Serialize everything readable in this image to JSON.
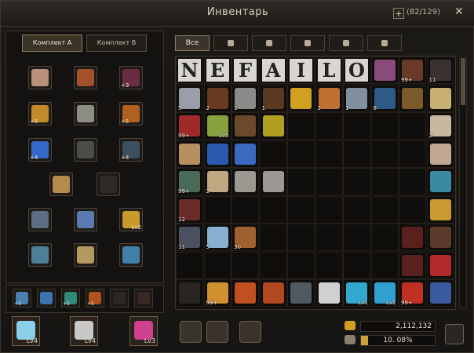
{
  "window": {
    "title": "Инвентарь",
    "capacity": "(82/129)",
    "close_glyph": "✕",
    "add_glyph": "+"
  },
  "equipment": {
    "presets": [
      "Комплект A",
      "Комплект B"
    ],
    "active_preset": 0,
    "slots": [
      {
        "c": "#b98f7a",
        "n": "",
        "lv": ""
      },
      {
        "c": "#a4502a",
        "n": "",
        "lv": ""
      },
      {
        "c": "#6b2b45",
        "n": "+3",
        "lv": ""
      },
      {
        "c": "#c48b2a",
        "n": "+5",
        "lv": ""
      },
      {
        "c": "#8d8c85",
        "n": "",
        "lv": ""
      },
      {
        "c": "#b06020",
        "n": "+5",
        "lv": ""
      },
      {
        "c": "#3468c8",
        "n": "+4",
        "lv": ""
      },
      {
        "c": "#4a4e47",
        "n": "",
        "lv": ""
      },
      {
        "c": "#3c4f5c",
        "n": "+4",
        "lv": ""
      },
      {
        "c": "#b58a4b",
        "n": "",
        "lv": ""
      },
      {
        "c": "#2d2a27",
        "n": "",
        "lv": ""
      },
      {
        "c": "#5b6e86",
        "n": "",
        "lv": ""
      },
      {
        "c": "#587ab0",
        "n": "",
        "lv": ""
      },
      {
        "c": "#c89a2e",
        "n": "",
        "lv": "Lv2"
      },
      {
        "c": "#4d7f99",
        "n": "",
        "lv": ""
      },
      {
        "c": "#b49960",
        "n": "",
        "lv": ""
      },
      {
        "c": "#3f7fa8",
        "n": "",
        "lv": ""
      }
    ]
  },
  "quickbar": [
    {
      "c": "#4b7fb0",
      "n": "+3"
    },
    {
      "c": "#3d73b0",
      "n": ""
    },
    {
      "c": "#2f8a7a",
      "n": "+5"
    },
    {
      "c": "#b0521e",
      "n": "+5"
    },
    {
      "c": "#2a2624",
      "n": ""
    },
    {
      "c": "#3a2623",
      "n": ""
    }
  ],
  "crystals": [
    {
      "c": "#8ad0e8",
      "lv": "Lv4"
    },
    {
      "c": "#c8c8c8",
      "lv": "Lv4"
    },
    {
      "c": "#d04090",
      "lv": "Lv3"
    }
  ],
  "tabs": [
    {
      "label": "Все",
      "icon": "all-tab"
    },
    {
      "label": "",
      "icon": "helmet-icon"
    },
    {
      "label": "",
      "icon": "potion-icon"
    },
    {
      "label": "",
      "icon": "gem-icon"
    },
    {
      "label": "",
      "icon": "hourglass-icon"
    },
    {
      "label": "",
      "icon": "key-icon"
    }
  ],
  "inventory": [
    {
      "r": 0,
      "c": 0,
      "letter": "N"
    },
    {
      "r": 0,
      "c": 1,
      "letter": "E"
    },
    {
      "r": 0,
      "c": 2,
      "letter": "F"
    },
    {
      "r": 0,
      "c": 3,
      "letter": "A"
    },
    {
      "r": 0,
      "c": 4,
      "letter": "I"
    },
    {
      "r": 0,
      "c": 5,
      "letter": "L"
    },
    {
      "r": 0,
      "c": 6,
      "letter": "O"
    },
    {
      "r": 0,
      "c": 7,
      "g": "#8a4a7a",
      "n": "",
      "lv": ""
    },
    {
      "r": 0,
      "c": 8,
      "g": "#6a3a28",
      "n": "99+",
      "lv": ""
    },
    {
      "r": 0,
      "c": 9,
      "g": "#3a3230",
      "n": "11",
      "lv": ""
    },
    {
      "r": 1,
      "c": 0,
      "g": "#9a9ea8",
      "n": "5",
      "lv": ""
    },
    {
      "r": 1,
      "c": 1,
      "g": "#6a3a20",
      "n": "2",
      "lv": ""
    },
    {
      "r": 1,
      "c": 2,
      "g": "#8a8a88",
      "n": "1",
      "lv": ""
    },
    {
      "r": 1,
      "c": 3,
      "g": "#5a3a22",
      "n": "1",
      "lv": ""
    },
    {
      "r": 1,
      "c": 4,
      "g": "#d0a020",
      "n": "",
      "lv": ""
    },
    {
      "r": 1,
      "c": 5,
      "g": "#c07030",
      "n": "2",
      "lv": ""
    },
    {
      "r": 1,
      "c": 6,
      "g": "#8090a0",
      "n": "1",
      "lv": ""
    },
    {
      "r": 1,
      "c": 7,
      "g": "#2e5a86",
      "n": "8",
      "lv": ""
    },
    {
      "r": 1,
      "c": 8,
      "g": "#7a5a2a",
      "n": "",
      "lv": ""
    },
    {
      "r": 1,
      "c": 9,
      "g": "#c8b070",
      "n": "",
      "lv": ""
    },
    {
      "r": 2,
      "c": 0,
      "g": "#a02a2a",
      "n": "99+",
      "lv": ""
    },
    {
      "r": 2,
      "c": 1,
      "g": "#88a040",
      "n": "",
      "lv": "Lv5"
    },
    {
      "r": 2,
      "c": 2,
      "g": "#6a4a2a",
      "n": "",
      "lv": ""
    },
    {
      "r": 2,
      "c": 3,
      "g": "#b0a020",
      "n": "",
      "lv": ""
    },
    {
      "r": 2,
      "c": 9,
      "g": "#c8b8a0",
      "n": "2",
      "lv": ""
    },
    {
      "r": 3,
      "c": 0,
      "g": "#b89060",
      "n": "",
      "lv": ""
    },
    {
      "r": 3,
      "c": 1,
      "g": "#2a5ab0",
      "n": "",
      "lv": ""
    },
    {
      "r": 3,
      "c": 2,
      "g": "#3a6ac0",
      "n": "",
      "lv": ""
    },
    {
      "r": 3,
      "c": 9,
      "g": "#c0a890",
      "n": "",
      "lv": ""
    },
    {
      "r": 4,
      "c": 0,
      "g": "#4a6a58",
      "n": "99+",
      "lv": ""
    },
    {
      "r": 4,
      "c": 1,
      "g": "#c0a880",
      "n": "2",
      "lv": ""
    },
    {
      "r": 4,
      "c": 2,
      "g": "#9a9890",
      "n": "",
      "lv": ""
    },
    {
      "r": 4,
      "c": 3,
      "g": "#9a9890",
      "n": "",
      "lv": ""
    },
    {
      "r": 4,
      "c": 9,
      "g": "#3a8aa0",
      "n": "",
      "lv": ""
    },
    {
      "r": 5,
      "c": 0,
      "g": "#6a2a2a",
      "n": "12",
      "lv": ""
    },
    {
      "r": 5,
      "c": 9,
      "g": "#c89a30",
      "n": "",
      "lv": ""
    },
    {
      "r": 6,
      "c": 0,
      "g": "#4a5060",
      "n": "11",
      "lv": ""
    },
    {
      "r": 6,
      "c": 1,
      "g": "#8ab0d0",
      "n": "5",
      "lv": ""
    },
    {
      "r": 6,
      "c": 2,
      "g": "#a06030",
      "n": "30",
      "lv": ""
    },
    {
      "r": 6,
      "c": 8,
      "g": "#5a2020",
      "n": "",
      "lv": ""
    },
    {
      "r": 6,
      "c": 9,
      "g": "#5a3a2a",
      "n": "",
      "lv": ""
    },
    {
      "r": 7,
      "c": 8,
      "g": "#5a2020",
      "n": "",
      "lv": ""
    },
    {
      "r": 7,
      "c": 9,
      "g": "#b02a2a",
      "n": "",
      "lv": ""
    },
    {
      "r": 8,
      "c": 0,
      "g": "#2a2420",
      "n": "",
      "lv": ""
    },
    {
      "r": 8,
      "c": 1,
      "g": "#d09030",
      "n": "99+",
      "lv": ""
    },
    {
      "r": 8,
      "c": 2,
      "g": "#c05020",
      "n": "",
      "lv": ""
    },
    {
      "r": 8,
      "c": 3,
      "g": "#b04820",
      "n": "",
      "lv": ""
    },
    {
      "r": 8,
      "c": 4,
      "g": "#505860",
      "n": "",
      "lv": ""
    },
    {
      "r": 8,
      "c": 5,
      "g": "#d0d0d0",
      "n": "",
      "lv": ""
    },
    {
      "r": 8,
      "c": 6,
      "g": "#30a8d0",
      "n": "",
      "lv": "Lv1"
    },
    {
      "r": 8,
      "c": 7,
      "g": "#30a0d0",
      "n": "",
      "lv": "Lv2"
    },
    {
      "r": 8,
      "c": 8,
      "g": "#c03020",
      "n": "99+",
      "lv": ""
    },
    {
      "r": 8,
      "c": 9,
      "g": "#3a5aa0",
      "n": "",
      "lv": ""
    }
  ],
  "footer": {
    "money": "2,112,132",
    "weight": "10. 08%",
    "weight_fraction": 0.1008
  },
  "actions": [
    "anvil-icon",
    "molecule-icon",
    "transfer-icon"
  ]
}
